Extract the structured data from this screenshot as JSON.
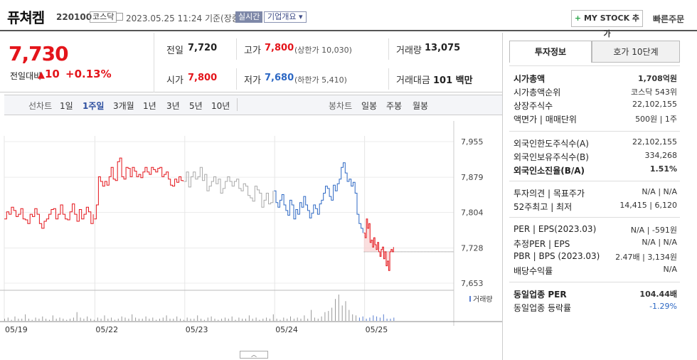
{
  "header": {
    "name": "퓨쳐켐",
    "code": "220100",
    "market": "코스닥",
    "datetime": "2023.05.25 11:24",
    "basis": "기준(장중)",
    "realtime": "실시간",
    "overview": "기업개요",
    "mystock": "MY STOCK 추가",
    "quick_order": "빠른주문"
  },
  "price": {
    "current": "7,730",
    "change_label": "전일대비",
    "change_amount": "10",
    "change_pct": "+0.13%",
    "prev_close_label": "전일",
    "prev_close": "7,720",
    "high_label": "고가",
    "high": "7,800",
    "upper_limit": "(상한가 10,030)",
    "volume_label": "거래량",
    "volume": "13,075",
    "open_label": "시가",
    "open": "7,800",
    "low_label": "저가",
    "low": "7,680",
    "lower_limit": "(하한가 5,410)",
    "amount_label": "거래대금",
    "amount": "101 백만"
  },
  "period_bar": {
    "line_label": "선차트",
    "line_tabs": [
      "1일",
      "1주일",
      "3개월",
      "1년",
      "3년",
      "5년",
      "10년"
    ],
    "active": "1주일",
    "candle_label": "봉차트",
    "candle_tabs": [
      "일봉",
      "주봉",
      "월봉"
    ]
  },
  "chart_data": {
    "type": "line",
    "ylim": [
      7653,
      7955
    ],
    "y_ticks": [
      "7,955",
      "7,879",
      "7,804",
      "7,728",
      "7,653"
    ],
    "x_ticks": [
      "05/19",
      "05/22",
      "05/23",
      "05/24",
      "05/25"
    ],
    "volume_legend": "거래량",
    "reference_price": 7720,
    "colors": {
      "up": "#e4151b",
      "down": "#2d68c4",
      "neutral": "#aaaaaa"
    },
    "series": [
      {
        "segment": "05/19",
        "values": [
          7790,
          7805,
          7800,
          7815,
          7808,
          7795,
          7800,
          7812,
          7790,
          7788,
          7780,
          7800,
          7795,
          7812,
          7800,
          7780,
          7770,
          7785,
          7790,
          7800,
          7810,
          7812,
          7790,
          7800,
          7820,
          7800,
          7790,
          7788,
          7805,
          7822,
          7800,
          7785,
          7810,
          7790,
          7800,
          7815,
          7805,
          7780,
          7800
        ]
      },
      {
        "segment": "05/22",
        "values": [
          7790,
          7820,
          7880,
          7870,
          7860,
          7870,
          7862,
          7880,
          7900,
          7875,
          7872,
          7912,
          7920,
          7880,
          7875,
          7900,
          7898,
          7880,
          7900,
          7892,
          7880,
          7885,
          7878,
          7890,
          7900,
          7890,
          7885,
          7900,
          7895,
          7890,
          7898,
          7900,
          7880,
          7885,
          7890,
          7875,
          7862,
          7860,
          7875,
          7868,
          7880,
          7872,
          7870
        ]
      },
      {
        "segment": "05/23",
        "values": [
          7870,
          7890,
          7858,
          7880,
          7890,
          7875,
          7880,
          7900,
          7872,
          7885,
          7850,
          7860,
          7870,
          7880,
          7865,
          7875,
          7845,
          7855,
          7870,
          7880,
          7870,
          7860,
          7870,
          7875,
          7855,
          7850,
          7865,
          7860,
          7840,
          7835,
          7828,
          7860,
          7852,
          7845,
          7815,
          7830,
          7845,
          7822,
          7825,
          7850
        ]
      },
      {
        "segment": "05/24",
        "values": [
          7850,
          7825,
          7815,
          7830,
          7842,
          7820,
          7808,
          7798,
          7830,
          7820,
          7790,
          7810,
          7800,
          7825,
          7815,
          7838,
          7820,
          7808,
          7792,
          7802,
          7820,
          7812,
          7800,
          7822,
          7830,
          7845,
          7860,
          7855,
          7838,
          7830,
          7862,
          7850,
          7865,
          7875,
          7900,
          7910,
          7888,
          7870,
          7875,
          7860,
          7868,
          7845,
          7800,
          7780,
          7770,
          7760
        ]
      },
      {
        "segment": "05/25",
        "values": [
          7760,
          7750,
          7790,
          7770,
          7780,
          7740,
          7745,
          7730,
          7750,
          7735,
          7725,
          7740,
          7720,
          7710,
          7725,
          7730,
          7705,
          7720,
          7690,
          7700,
          7680,
          7720,
          7725,
          7720,
          7730
        ]
      }
    ],
    "volume": [
      2,
      3,
      1,
      4,
      2,
      2,
      6,
      2,
      1,
      3,
      2,
      4,
      2,
      1,
      5,
      2,
      3,
      2,
      1,
      2,
      3,
      8,
      3,
      2,
      4,
      2,
      1,
      3,
      2,
      5,
      2,
      3,
      1,
      2,
      4,
      3,
      2,
      6,
      3,
      2,
      2,
      4,
      2,
      3,
      1,
      2,
      3,
      5,
      2,
      2,
      4,
      2,
      1,
      3,
      2,
      2,
      5,
      2,
      1,
      3,
      4,
      2,
      1,
      2,
      3,
      2,
      4,
      1,
      3,
      2,
      2,
      5,
      2,
      3,
      1,
      2,
      3,
      2,
      6,
      2,
      1,
      3,
      2,
      4,
      2,
      3,
      2,
      5,
      2,
      10,
      3,
      2,
      4,
      8,
      9,
      12,
      20,
      24,
      14,
      18,
      10,
      6,
      5,
      3,
      4,
      2,
      3,
      5,
      4,
      3,
      6,
      2,
      2,
      3
    ]
  },
  "right_panel": {
    "tabs": [
      "투자정보",
      "호가 10단계"
    ],
    "active_tab": "투자정보",
    "group1": [
      {
        "k": "시가총액",
        "v": "1,708억원"
      },
      {
        "k": "시가총액순위",
        "v": "코스닥 543위"
      },
      {
        "k": "상장주식수",
        "v": "22,102,155"
      },
      {
        "k": "액면가 | 매매단위",
        "v": "500원 | 1주"
      }
    ],
    "group2": [
      {
        "k": "외국인한도주식수(A)",
        "v": "22,102,155"
      },
      {
        "k": "외국인보유주식수(B)",
        "v": "334,268"
      },
      {
        "k": "외국인소진율(B/A)",
        "v": "1.51%"
      }
    ],
    "group3": [
      {
        "k": "투자의견 | 목표주가",
        "v": "N/A | N/A"
      },
      {
        "k": "52주최고 | 최저",
        "v": "14,415 | 6,120"
      }
    ],
    "group4": [
      {
        "k": "PER | EPS(2023.03)",
        "v": "N/A | -591원"
      },
      {
        "k": "추정PER | EPS",
        "v": "N/A | N/A"
      },
      {
        "k": "PBR | BPS (2023.03)",
        "v": "2.47배 | 3,134원"
      },
      {
        "k": "배당수익률",
        "v": "N/A"
      }
    ],
    "group5": [
      {
        "k": "동일업종 PER",
        "v": "104.44배"
      },
      {
        "k": "동일업종 등락률",
        "v": "-1.29%"
      }
    ]
  }
}
